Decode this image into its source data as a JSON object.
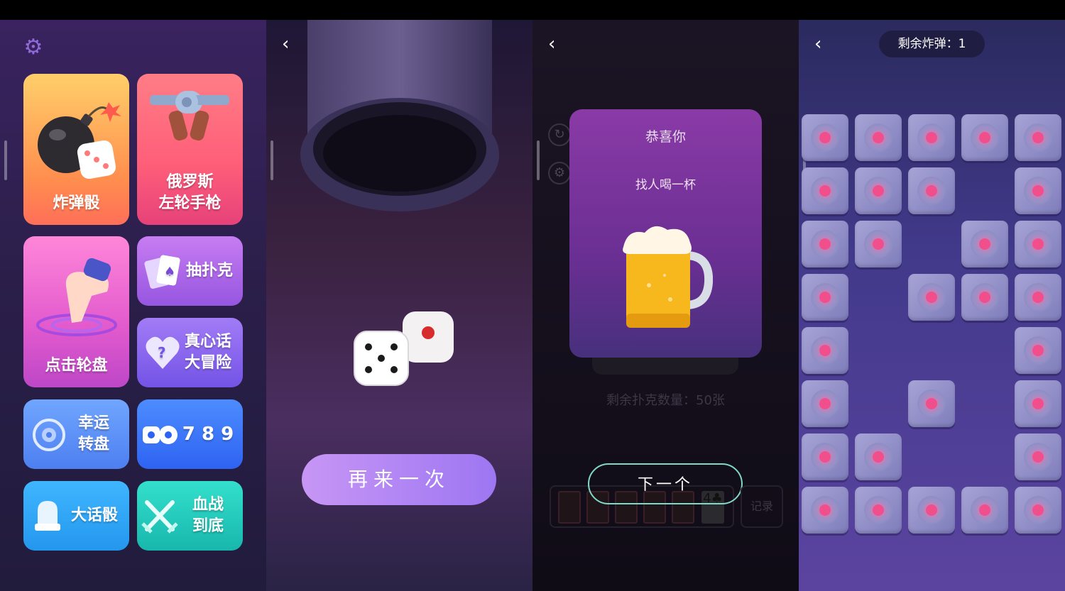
{
  "home": {
    "tiles": {
      "bomb": "炸弹骰",
      "revolver": "俄罗斯\n左轮手枪",
      "tap_wheel": "点击轮盘",
      "poker": "抽扑克",
      "truth_dare": "真心话\n大冒险",
      "lucky_wheel": "幸运\n转盘",
      "game_789": "7 8 9",
      "liar_dice": "大话骰",
      "blood_battle": "血战\n到底"
    }
  },
  "dice_screen": {
    "retry_label": "再来一次",
    "dice": [
      {
        "face": 5
      },
      {
        "face": 1
      }
    ]
  },
  "card_screen": {
    "card_title": "恭喜你",
    "card_task": "找人喝一杯",
    "remaining": "剩余扑克数量：50张",
    "next_label": "下一个",
    "record_label": "记录",
    "deck_top_card": "4♣"
  },
  "bomb_screen": {
    "remaining_bombs": "剩余炸弹：1",
    "grid": [
      [
        1,
        1,
        1,
        1,
        1
      ],
      [
        1,
        1,
        1,
        0,
        1
      ],
      [
        1,
        1,
        0,
        1,
        1
      ],
      [
        1,
        0,
        1,
        1,
        1
      ],
      [
        1,
        0,
        0,
        0,
        1
      ],
      [
        1,
        0,
        1,
        0,
        1
      ],
      [
        1,
        1,
        0,
        0,
        1
      ],
      [
        1,
        1,
        1,
        1,
        1
      ]
    ]
  },
  "colors": {
    "accent_purple": "#9d76f2",
    "bomb_dot": "#f14f8b",
    "next_border": "#7fd9c7"
  }
}
